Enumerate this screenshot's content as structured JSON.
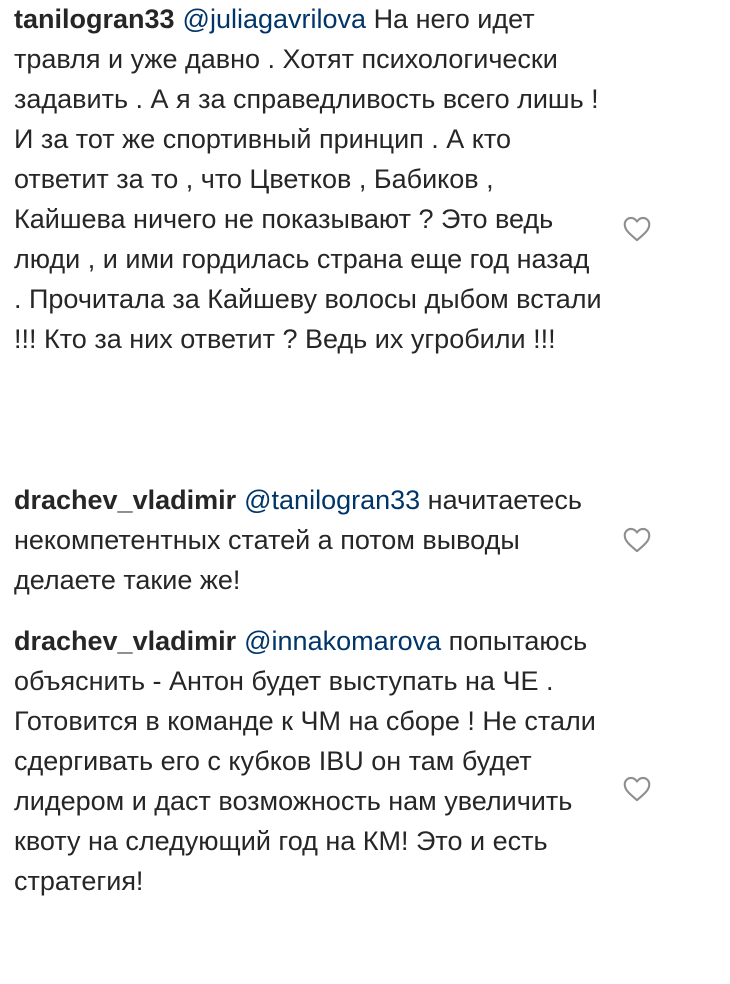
{
  "comments": [
    {
      "username": "tanilogran33",
      "mention": "@juliagavrilova",
      "text": "На него идет травля и уже давно . Хотят психологически задавить . А я за справедливость всего лишь ! И за тот же спортивный принцип . А кто ответит за то , что Цветков , Бабиков , Кайшева ничего не показывают ? Это ведь люди , и ими гордилась страна еще год назад . Прочитала за Кайшеву волосы дыбом встали !!! Кто за них ответит ? Ведь их угробили !!!",
      "like_icon": "heart-outline-icon"
    },
    {
      "username": "drachev_vladimir",
      "mention": "@tanilogran33",
      "text": "начитаетесь некомпетентных статей а потом выводы делаете такие же!",
      "like_icon": "heart-outline-icon"
    },
    {
      "username": "drachev_vladimir",
      "mention": "@innakomarova",
      "text": "попытаюсь объяснить - Антон будет выступать на ЧЕ . Готовится в команде к ЧМ на сборе ! Не стали сдергивать его с кубков IBU он там будет лидером и даст возможность нам увеличить квоту на следующий год на КМ! Это и есть стратегия!",
      "like_icon": "heart-outline-icon"
    }
  ],
  "colors": {
    "text": "#262626",
    "mention": "#003569",
    "icon": "#8e8e8e"
  }
}
